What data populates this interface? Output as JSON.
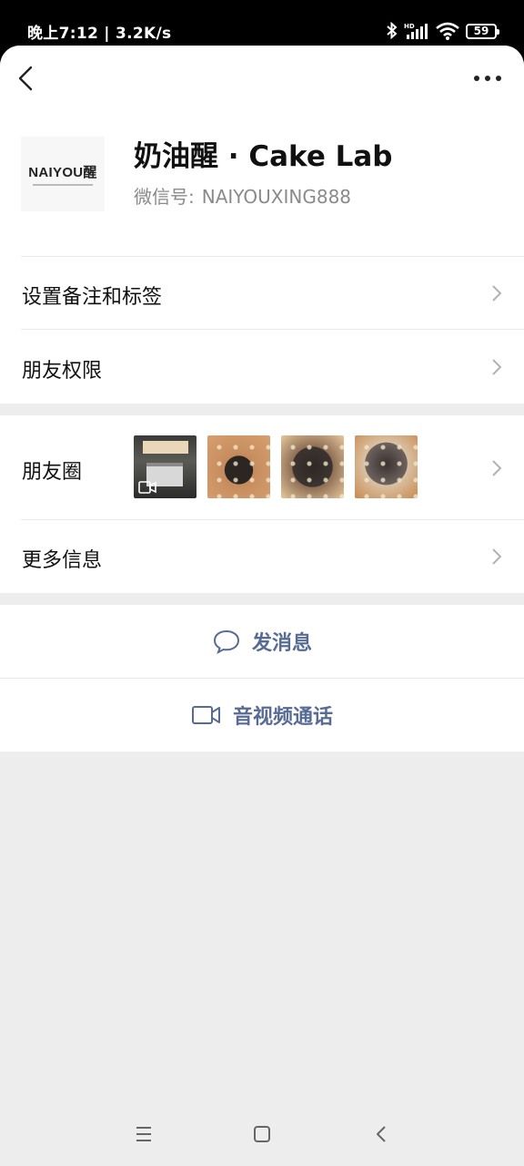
{
  "status_bar": {
    "time_speed": "晚上7:12 | 3.2K/s",
    "battery": "59",
    "icons": [
      "bluetooth-icon",
      "hd-signal-icon",
      "wifi-icon",
      "battery-icon"
    ]
  },
  "top_bar": {
    "back_icon": "chevron-left-icon",
    "more_icon": "more-dots-icon"
  },
  "profile": {
    "avatar_text": "NAIYOU醒",
    "name": "奶油醒 · Cake Lab",
    "wechat_id_label": "微信号:",
    "wechat_id": "NAIYOUXING888"
  },
  "settings": [
    {
      "label": "设置备注和标签"
    },
    {
      "label": "朋友权限"
    }
  ],
  "moments": {
    "label": "朋友圈",
    "thumb_count": 4
  },
  "more_info": {
    "label": "更多信息"
  },
  "actions": {
    "message": "发消息",
    "call": "音视频通话"
  },
  "colors": {
    "link_blue": "#576b95",
    "background": "#ededed",
    "divider": "#e8e8e8",
    "secondary_text": "#8a8a8a"
  }
}
